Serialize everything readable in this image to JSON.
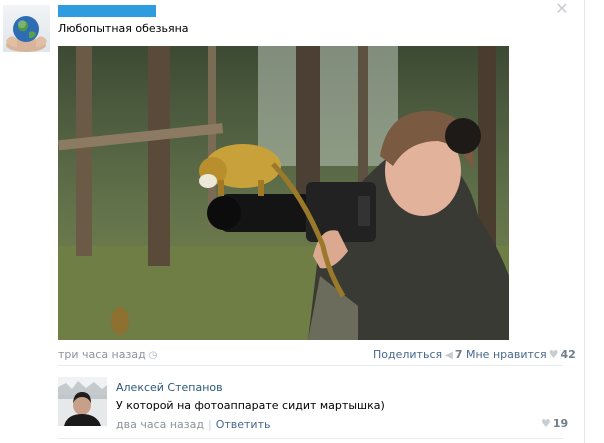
{
  "post": {
    "text": "Любопытная обезьяна",
    "time": "три часа назад",
    "share_label": "Поделиться",
    "share_count": "7",
    "like_label": "Мне нравится",
    "like_count": "42"
  },
  "comment": {
    "author": "Алексей Степанов",
    "text": "У которой на фотоаппарате сидит мартышка)",
    "time": "два часа назад",
    "reply_label": "Ответить",
    "like_count": "19"
  },
  "icons": {
    "close": "close-icon",
    "clock": "clock-icon",
    "share": "megaphone-icon",
    "like": "heart-icon"
  },
  "colors": {
    "link": "#45688e",
    "author": "#2b587a",
    "muted": "#8a929b",
    "redaction": "#2f9ce0"
  }
}
